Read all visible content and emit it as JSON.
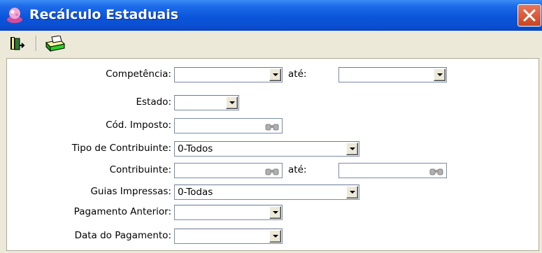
{
  "window": {
    "title": "Recálculo Estaduais"
  },
  "form": {
    "competencia": {
      "label": "Competência:",
      "ate_label": "até:",
      "value": "",
      "ate_value": ""
    },
    "estado": {
      "label": "Estado:",
      "value": ""
    },
    "cod_imposto": {
      "label": "Cód. Imposto:",
      "value": ""
    },
    "tipo_contribuinte": {
      "label": "Tipo de Contribuinte:",
      "value": "0-Todos"
    },
    "contribuinte": {
      "label": "Contribuinte:",
      "ate_label": "até:",
      "value": "",
      "ate_value": ""
    },
    "guias_impressas": {
      "label": "Guias Impressas:",
      "value": "0-Todas"
    },
    "pagamento_anterior": {
      "label": "Pagamento Anterior:",
      "value": ""
    },
    "data_pagamento": {
      "label": "Data do Pagamento:",
      "value": ""
    }
  },
  "icons": {
    "window": "app-icon",
    "close": "close-icon",
    "exit": "exit-door-icon",
    "print": "print-icon",
    "search": "binoculars-icon"
  },
  "colors": {
    "titlebar": "#0a55db",
    "close": "#d9583a",
    "panel": "#ffffff",
    "frame": "#ece9d8"
  }
}
